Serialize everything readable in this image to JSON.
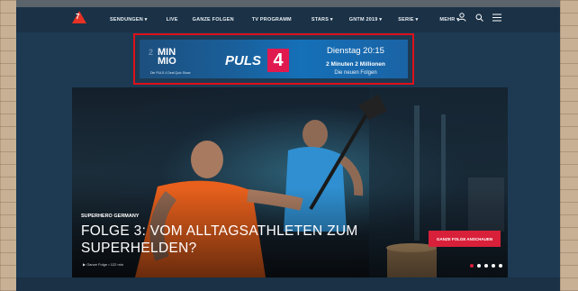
{
  "nav": {
    "logo_number": "7",
    "items": [
      "SENDUNGEN ▾",
      "LIVE",
      "GANZE FOLGEN",
      "TV PROGRAMM",
      "STARS ▾",
      "GNTM 2019 ▾",
      "SERIE ▾",
      "MEHR ▾"
    ],
    "icons": [
      "user-icon",
      "search-icon",
      "menu-icon"
    ]
  },
  "ad": {
    "brand_faint": "2",
    "brand_main": "MIN\nMIO",
    "tagline": "Die PULS 4 Deal Quiz Show",
    "channel_text": "PULS",
    "channel_number": "4",
    "date": "Dienstag 20:15",
    "line1": "2 Minuten 2 Millionen",
    "line2": "Die neuen Folgen",
    "border_color": "#e0101a"
  },
  "hero": {
    "kicker": "SUPERHERO GERMANY",
    "title": "FOLGE 3: VOM ALLTAGSATHLETEN ZUM SUPERHELDEN?",
    "meta": "▶  Ganze Folge • 122 min",
    "cta": "GANZE FOLGE ANSCHAUEN",
    "slide_count": 5,
    "active_slide": 1,
    "accent": "#d8203a"
  }
}
